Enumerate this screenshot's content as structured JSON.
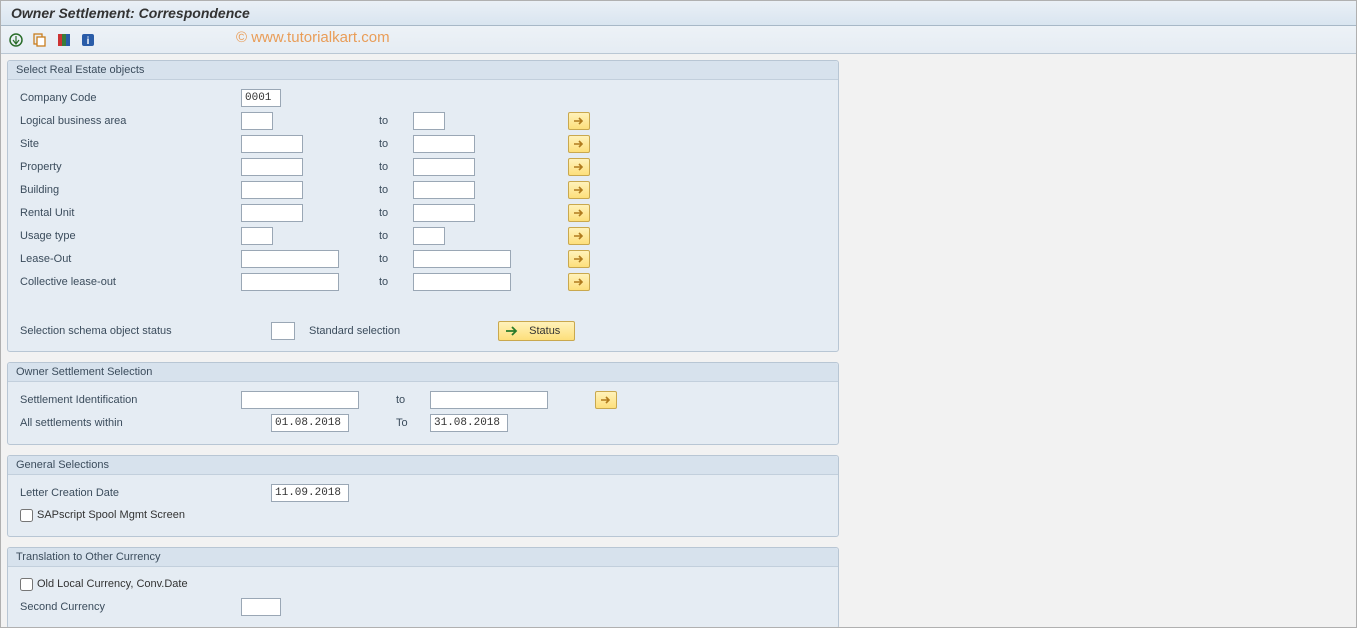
{
  "title": "Owner Settlement: Correspondence",
  "watermark": "© www.tutorialkart.com",
  "group_re": {
    "title": "Select Real Estate objects",
    "company_code_label": "Company Code",
    "company_code_value": "0001",
    "rows": [
      {
        "label": "Logical business area",
        "to": "to",
        "size": "s"
      },
      {
        "label": "Site",
        "to": "to",
        "size": "m"
      },
      {
        "label": "Property",
        "to": "to",
        "size": "m"
      },
      {
        "label": "Building",
        "to": "to",
        "size": "m"
      },
      {
        "label": "Rental Unit",
        "to": "to",
        "size": "m"
      },
      {
        "label": "Usage type",
        "to": "to",
        "size": "s"
      },
      {
        "label": "Lease-Out",
        "to": "to",
        "size": "l"
      },
      {
        "label": "Collective lease-out",
        "to": "to",
        "size": "l"
      }
    ],
    "schema_label": "Selection schema object status",
    "schema_after": "Standard selection",
    "status_button": "Status"
  },
  "group_settle": {
    "title": "Owner Settlement Selection",
    "ident_label": "Settlement Identification",
    "ident_to": "to",
    "within_label": "All settlements within",
    "within_from": "01.08.2018",
    "within_to_label": "To",
    "within_to": "31.08.2018"
  },
  "group_general": {
    "title": "General Selections",
    "letter_date_label": "Letter Creation Date",
    "letter_date_value": "11.09.2018",
    "spool_label": "SAPscript Spool Mgmt Screen"
  },
  "group_currency": {
    "title": "Translation to Other Currency",
    "old_local_label": "Old Local Currency, Conv.Date",
    "second_currency_label": "Second Currency"
  }
}
